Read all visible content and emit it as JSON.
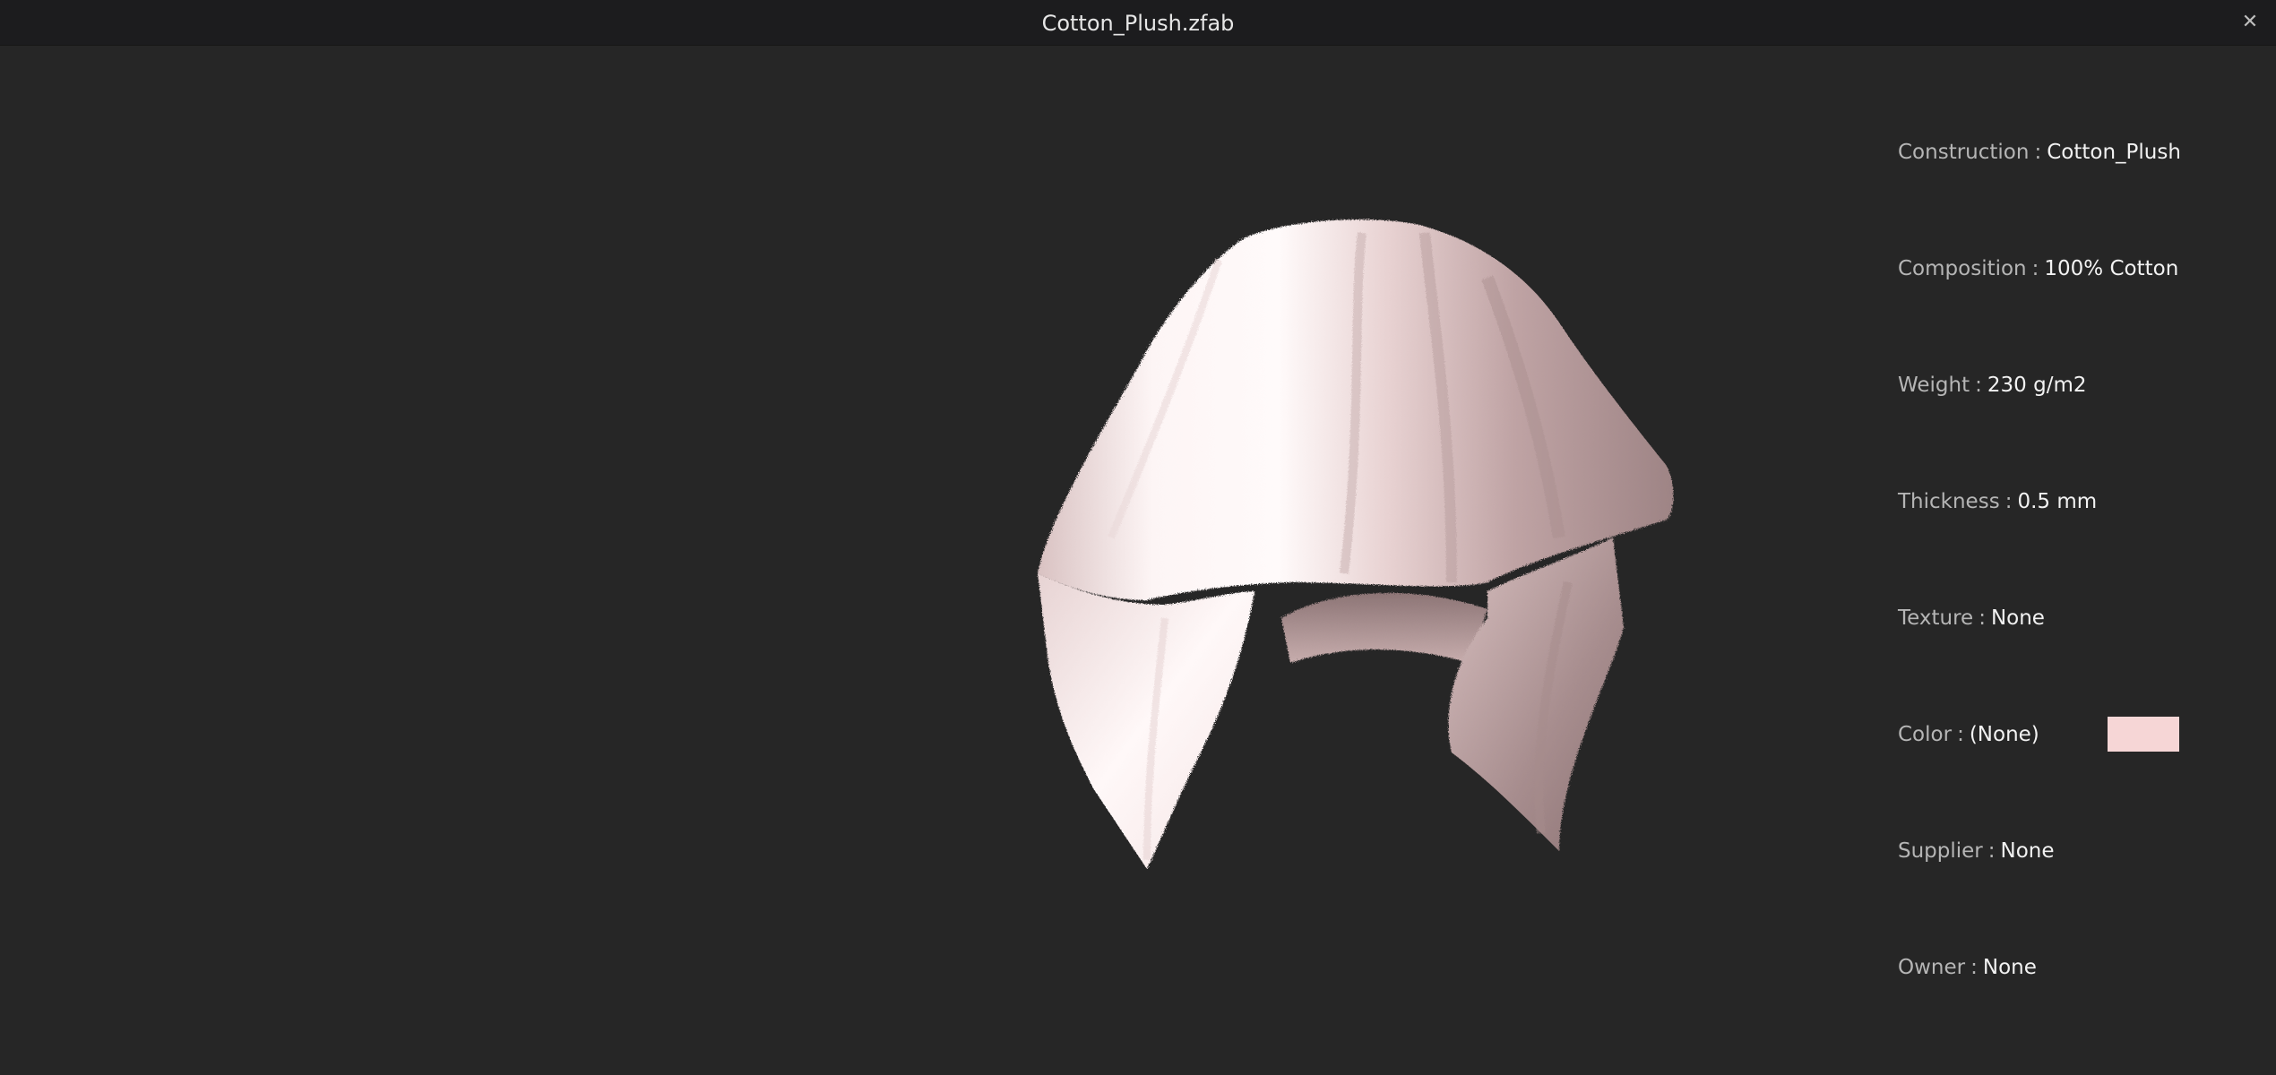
{
  "window": {
    "title": "Cotton_Plush.zfab",
    "close_glyph": "✕",
    "close_icon": "close-icon"
  },
  "preview": {
    "subject": "fabric-drape-preview",
    "fabric_color": "#f4d8d8"
  },
  "properties": [
    {
      "label": "Construction",
      "value": "Cotton_Plush"
    },
    {
      "label": "Composition",
      "value": "100% Cotton"
    },
    {
      "label": "Weight",
      "value": "230 g/m2"
    },
    {
      "label": "Thickness",
      "value": "0.5 mm"
    },
    {
      "label": "Texture",
      "value": "None"
    },
    {
      "label": "Color",
      "value": "(None)"
    },
    {
      "label": "Supplier",
      "value": "None"
    },
    {
      "label": "Owner",
      "value": "None"
    }
  ],
  "separator": ":",
  "color_swatch": "#f6d6d6",
  "colors": {
    "background": "#262626",
    "titlebar": "#1c1c1e",
    "label": "#b5b5b5",
    "value": "#f2f2f2"
  }
}
